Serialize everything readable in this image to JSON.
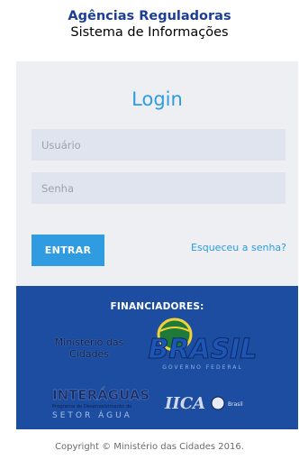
{
  "header": {
    "title": "Agências Reguladoras",
    "subtitle": "Sistema de Informações"
  },
  "login": {
    "title": "Login",
    "username_placeholder": "Usuário",
    "password_placeholder": "Senha",
    "submit_label": "ENTRAR",
    "forgot_label": "Esqueceu a senha?"
  },
  "sponsors": {
    "label": "FINANCIADORES:",
    "ministerio_line1": "Ministério das",
    "ministerio_line2": "Cidades",
    "brasil_text": "BRASIL",
    "brasil_sub": "GOVERNO FEDERAL",
    "interaguas_title": "INTERÁGUAS",
    "interaguas_sub": "Programa de Desenvolvimento do",
    "interaguas_sub2": "SETOR ÁGUA",
    "iica_text": "IICA",
    "iica_country": "Brasil"
  },
  "footer": {
    "copyright": "Copyright © Ministério das Cidades 2016."
  },
  "colors": {
    "accent": "#2f9be0",
    "brand_dark": "#1c3f94",
    "sponsor_bg": "#1d4da0",
    "panel_bg": "#edeff3"
  }
}
